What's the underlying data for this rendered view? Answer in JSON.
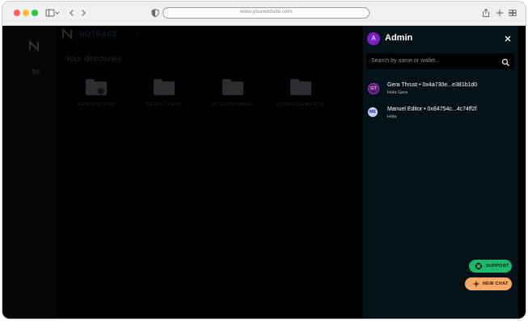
{
  "browser": {
    "url": "www.yourwebsite.com"
  },
  "background": {
    "brand": "NOTRACE",
    "heading": "Your directories",
    "side_text": "Yc",
    "folders": [
      {
        "label": "ADMINISTORE"
      },
      {
        "label": "DEVELOPERS"
      },
      {
        "label": "ACCOUNTANCE"
      },
      {
        "label": "DISBURSEMENTS"
      }
    ]
  },
  "panel": {
    "avatar_letter": "A",
    "title": "Admin",
    "search_placeholder": "Search by name or wallet...",
    "chats": [
      {
        "initials": "GT",
        "title": "Gera Thrust • 0x4a730e...e381b1d0",
        "message": "Hola Gera",
        "bg": "#5a1a6e",
        "fg": "#e8b8ff"
      },
      {
        "initials": "ME",
        "title": "Manuel Editor • 0x84754c...4c74ff2f",
        "message": "Hola",
        "bg": "#c9d3ff",
        "fg": "#1d2b8a"
      }
    ],
    "support_label": "SUPPORT",
    "new_chat_label": "NEW CHAT"
  },
  "colors": {
    "panel_bg": "#04131a",
    "support": "#1bb96a",
    "new_chat": "#f7a96a",
    "admin_avatar": "#7b1fc8"
  }
}
